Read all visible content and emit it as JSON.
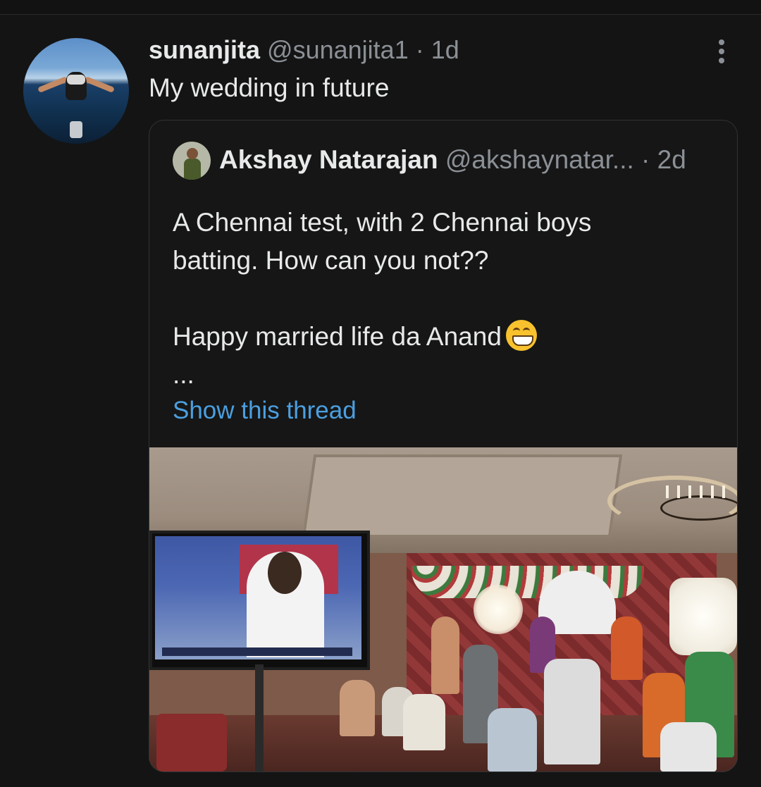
{
  "tweet": {
    "author_name": "sunanjita",
    "author_handle": "@sunanjita1",
    "separator": "·",
    "time": "1d",
    "text": "My wedding in future",
    "avatar_alt": "avatar",
    "more_icon": "more-vertical-icon"
  },
  "quoted_tweet": {
    "author_name": "Akshay Natarajan",
    "author_handle": "@akshaynatar...",
    "separator": "·",
    "time": "2d",
    "text_line1": "A Chennai test, with 2 Chennai boys",
    "text_line2": "batting. How can you not??",
    "text_line3": "Happy married life da Anand",
    "emoji": "grinning-face-icon",
    "ellipsis": "...",
    "show_thread_label": "Show this thread"
  },
  "colors": {
    "background": "#141414",
    "text": "#e7e9ea",
    "secondary_text": "#8b9096",
    "link": "#4b9fe0",
    "border": "#2f3336"
  }
}
